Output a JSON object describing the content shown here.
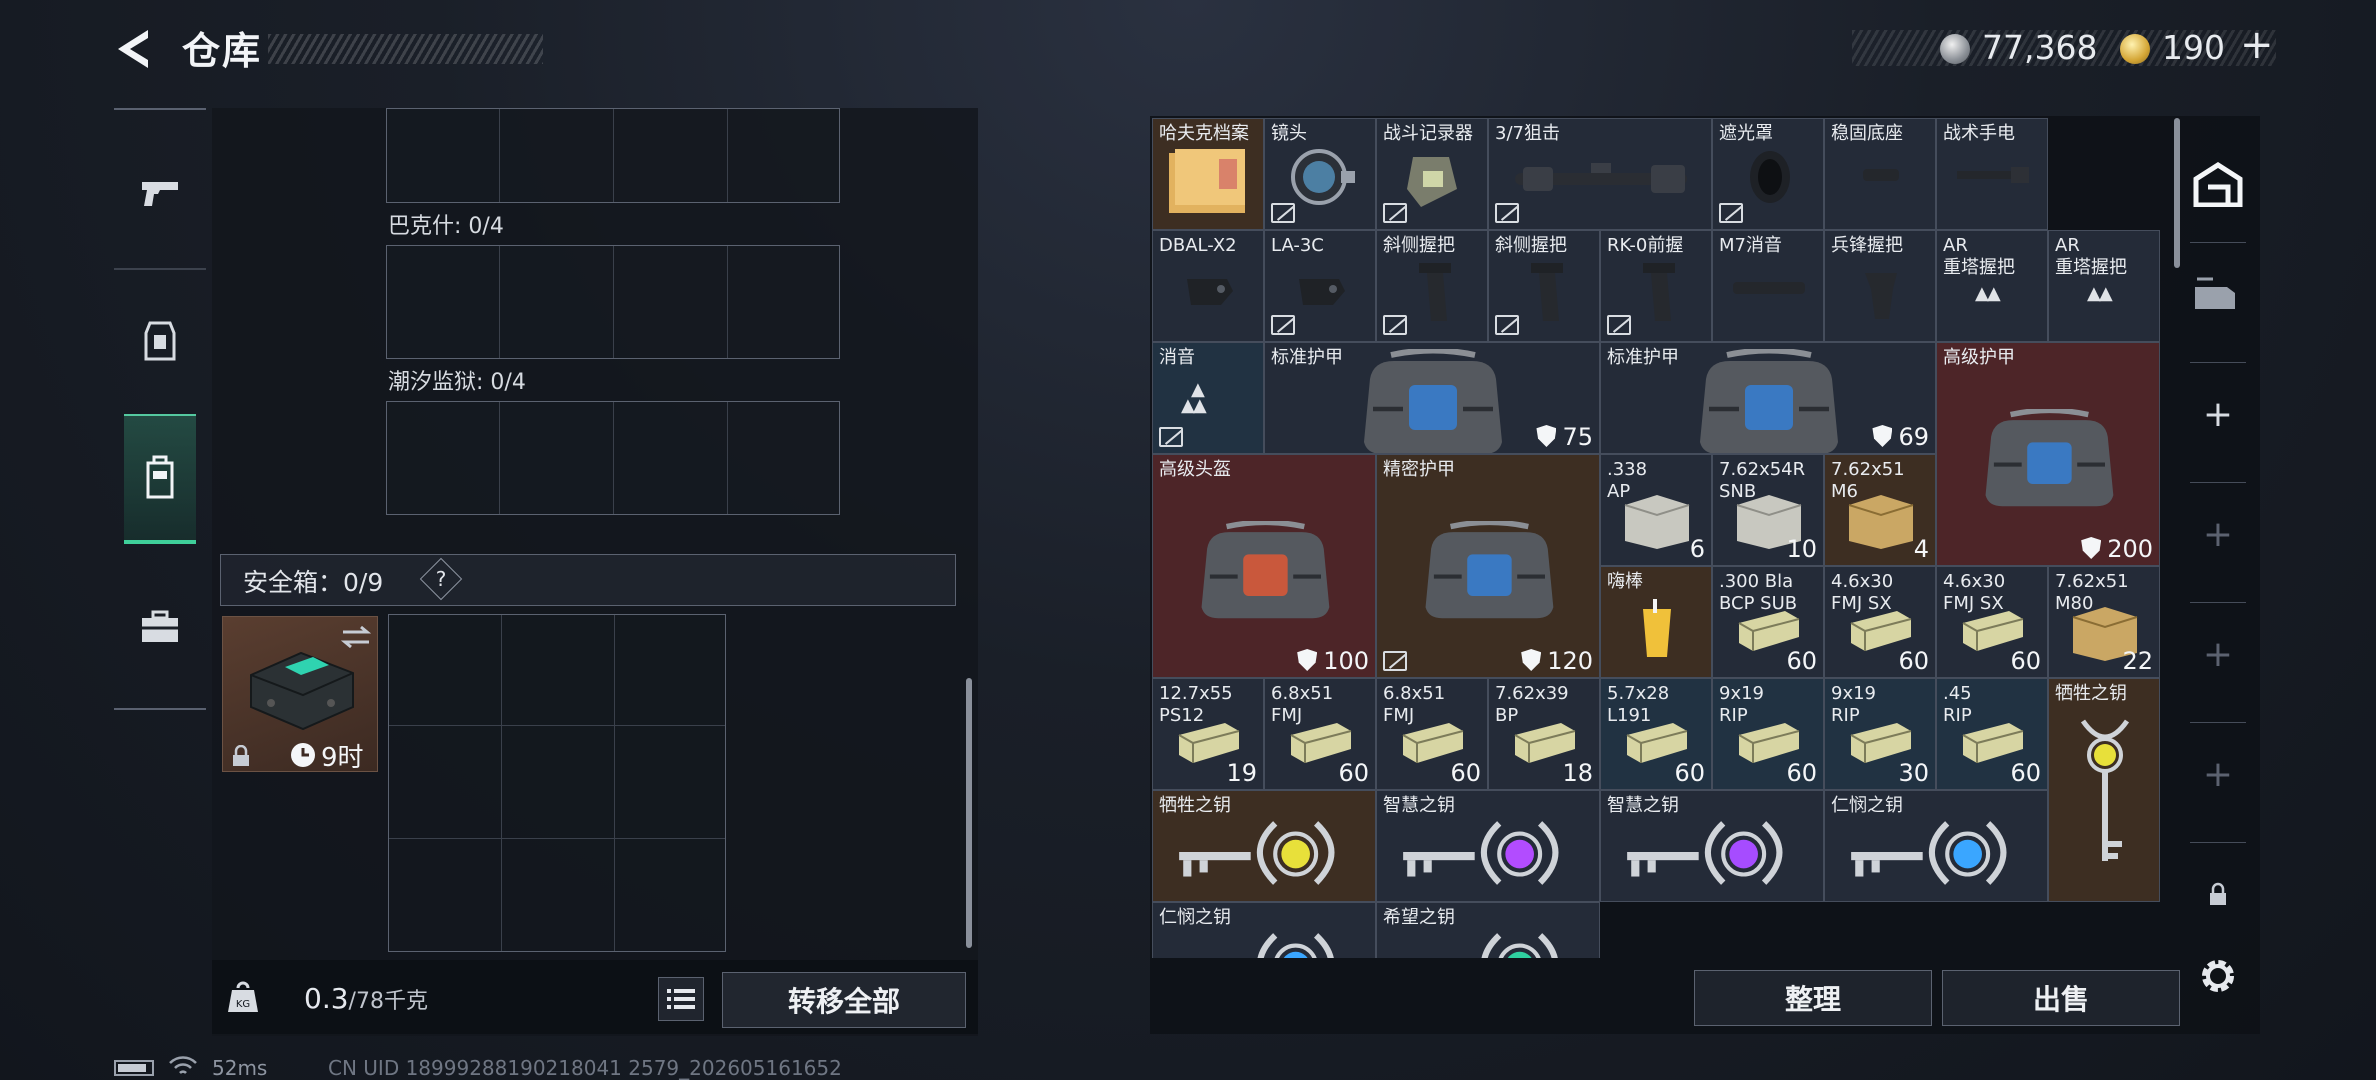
{
  "header": {
    "title": "仓库",
    "currency": [
      {
        "name": "silver-coin",
        "value": "77,368"
      },
      {
        "name": "gold-coin",
        "value": "190"
      }
    ],
    "gold_add": "+"
  },
  "left_nav": [
    {
      "icon": "pistol-icon",
      "active": false
    },
    {
      "icon": "armor-vest-icon",
      "active": false
    },
    {
      "icon": "backpack-icon",
      "active": true
    },
    {
      "icon": "briefcase-icon",
      "active": false
    }
  ],
  "containers": [
    {
      "label": ""
    },
    {
      "label": "巴克什: 0/4"
    },
    {
      "label": "潮汐监狱: 0/4"
    }
  ],
  "safe_box": {
    "label": "安全箱：0/9",
    "help": "?",
    "timer": "9时"
  },
  "weight": {
    "current": "0.3",
    "max": "/78千克"
  },
  "buttons": {
    "transfer_all": "转移全部",
    "sort": "整理",
    "sell": "出售"
  },
  "storage": {
    "items": [
      {
        "name": "哈夫克档案",
        "count": "",
        "color": "gold"
      },
      {
        "name": "镜头",
        "count": "",
        "color": "gray"
      },
      {
        "name": "战斗记录器",
        "count": "",
        "color": "gray"
      },
      {
        "name": "3/7狙击",
        "count": "",
        "color": "gray"
      },
      {
        "name": "遮光罩",
        "count": "",
        "color": "gray"
      },
      {
        "name": "稳固底座",
        "count": "",
        "color": "gray"
      },
      {
        "name": "战术手电",
        "count": "",
        "color": "gray"
      },
      {
        "name": "DBAL-X2",
        "count": "",
        "color": "gray"
      },
      {
        "name": "LA-3C",
        "count": "",
        "color": "gray"
      },
      {
        "name": "斜侧握把",
        "count": "",
        "color": "gray"
      },
      {
        "name": "斜侧握把",
        "count": "",
        "color": "gray"
      },
      {
        "name": "RK-0前握",
        "count": "",
        "color": "gray"
      },
      {
        "name": "M7消音",
        "count": "",
        "color": "gray"
      },
      {
        "name": "兵锋握把",
        "count": "",
        "color": "gray"
      },
      {
        "name": "AR\n重塔握把",
        "count": "",
        "color": "gray"
      },
      {
        "name": "AR\n重塔握把",
        "count": "",
        "color": "gray"
      },
      {
        "name": "消音",
        "count": "",
        "color": "blue"
      },
      {
        "name": "标准护甲",
        "count": "75",
        "color": "gray"
      },
      {
        "name": "标准护甲",
        "count": "69",
        "color": "gray"
      },
      {
        "name": "高级护甲",
        "count": "200",
        "color": "red"
      },
      {
        "name": "高级头盔",
        "count": "100",
        "color": "red"
      },
      {
        "name": "精密护甲",
        "count": "120",
        "color": "gold"
      },
      {
        "name": ".338\nAP",
        "count": "6",
        "color": "gray"
      },
      {
        "name": "7.62x54R\nSNB",
        "count": "10",
        "color": "gray"
      },
      {
        "name": "7.62x51\nM6",
        "count": "4",
        "color": "gold"
      },
      {
        "name": "嗨棒",
        "count": "",
        "color": "gold"
      },
      {
        "name": ".300 Bla\nBCP SUB",
        "count": "60",
        "color": "gray"
      },
      {
        "name": "4.6x30\nFMJ SX",
        "count": "60",
        "color": "gray"
      },
      {
        "name": "4.6x30\nFMJ SX",
        "count": "60",
        "color": "gray"
      },
      {
        "name": "7.62x51\nM80",
        "count": "22",
        "color": "gray"
      },
      {
        "name": "12.7x55\nPS12",
        "count": "19",
        "color": "gray"
      },
      {
        "name": "6.8x51\nFMJ",
        "count": "60",
        "color": "gray"
      },
      {
        "name": "6.8x51\nFMJ",
        "count": "60",
        "color": "gray"
      },
      {
        "name": "7.62x39\nBP",
        "count": "18",
        "color": "gray"
      },
      {
        "name": "5.7x28\nL191",
        "count": "60",
        "color": "blue"
      },
      {
        "name": "9x19\nRIP",
        "count": "60",
        "color": "blue"
      },
      {
        "name": "9x19\nRIP",
        "count": "30",
        "color": "blue"
      },
      {
        "name": ".45\nRIP",
        "count": "60",
        "color": "blue"
      },
      {
        "name": "牺牲之钥",
        "count": "",
        "color": "gold"
      },
      {
        "name": "牺牲之钥",
        "count": "",
        "color": "gold"
      },
      {
        "name": "智慧之钥",
        "count": "",
        "color": "gray"
      },
      {
        "name": "智慧之钥",
        "count": "",
        "color": "gray"
      },
      {
        "name": "仁悯之钥",
        "count": "",
        "color": "gray"
      },
      {
        "name": "仁悯之钥",
        "count": "",
        "color": "gray"
      },
      {
        "name": "希望之钥",
        "count": "",
        "color": "gray"
      }
    ]
  },
  "right_nav": [
    {
      "icon": "warehouse-icon"
    },
    {
      "icon": "deposit-icon"
    },
    {
      "icon": "add-tab-icon"
    },
    {
      "icon": "add-tab-icon"
    },
    {
      "icon": "add-tab-icon"
    },
    {
      "icon": "add-tab-icon"
    },
    {
      "icon": "lock-icon"
    },
    {
      "icon": "settings-gear-icon"
    }
  ],
  "footer": {
    "ping": "52ms",
    "uid": "CN UID 18999288190218041 2579_202605161652"
  },
  "colors": {
    "accent_green": "#3fcf9a",
    "rarity_red": "#4d2528",
    "rarity_gold": "#3d2e22",
    "rarity_blue": "#213242",
    "rarity_gray": "#242b38"
  }
}
